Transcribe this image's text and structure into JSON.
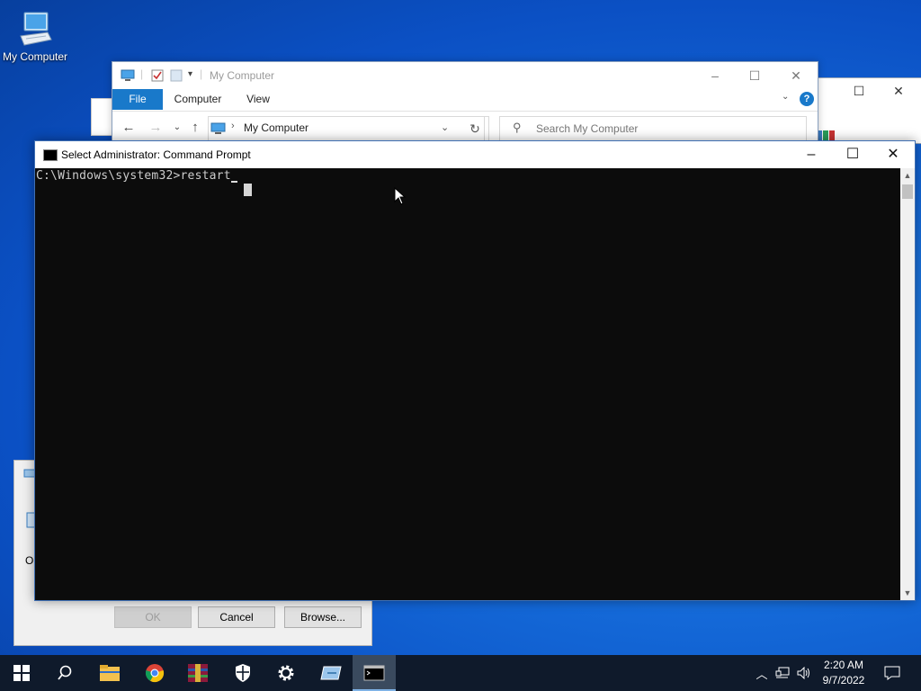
{
  "desktop": {
    "icon_label": "My Computer"
  },
  "explorer": {
    "title": "My Computer",
    "ribbon_tabs": [
      "File",
      "Computer",
      "View"
    ],
    "address": "My Computer",
    "search_placeholder": "Search My Computer"
  },
  "cmd": {
    "title": "Select Administrator: Command Prompt",
    "line": "C:\\Windows\\system32>restart"
  },
  "dialog": {
    "fragment": "O",
    "buttons": {
      "ok": "OK",
      "cancel": "Cancel",
      "browse": "Browse..."
    }
  },
  "taskbar": {
    "time": "2:20 AM",
    "date": "9/7/2022",
    "apps": [
      "start",
      "search",
      "file-explorer",
      "chrome",
      "winrar",
      "windows-security",
      "settings",
      "run-dialog",
      "command-prompt"
    ]
  },
  "colors": {
    "accent": "#1979ca",
    "desktop": "#0b50c4",
    "taskbar": "#0f1a2b"
  }
}
